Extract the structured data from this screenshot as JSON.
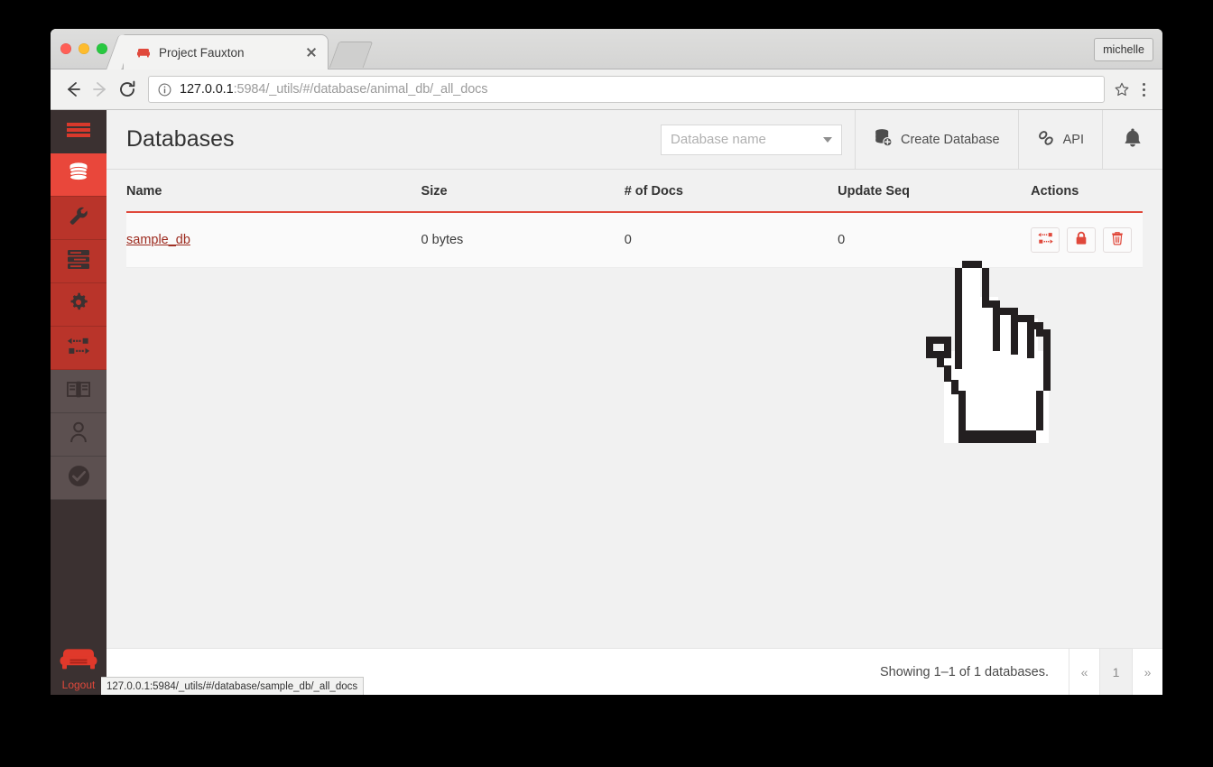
{
  "browser": {
    "tab": {
      "title": "Project Fauxton",
      "favicon_icon": "couch-favicon",
      "close_icon": "close-icon"
    },
    "new_tab_icon": "new-tab-icon",
    "profile_label": "michelle",
    "nav": {
      "back_icon": "back-arrow-icon",
      "forward_icon": "forward-arrow-icon",
      "reload_icon": "reload-icon"
    },
    "url": {
      "info_icon": "info-circle-icon",
      "host": "127.0.0.1",
      "path": ":5984/_utils/#/database/animal_db/_all_docs",
      "star_icon": "bookmark-star-icon",
      "menu_icon": "three-dot-menu-icon"
    },
    "status_link": "127.0.0.1:5984/_utils/#/database/sample_db/_all_docs"
  },
  "sidebar": {
    "items": [
      {
        "name": "menu-toggle",
        "icon": "hamburger-icon",
        "style": "burger"
      },
      {
        "name": "databases",
        "icon": "database-icon",
        "style": "red active"
      },
      {
        "name": "setup",
        "icon": "wrench-icon",
        "style": "red"
      },
      {
        "name": "active-tasks",
        "icon": "server-list-icon",
        "style": "red"
      },
      {
        "name": "configuration",
        "icon": "gear-icon",
        "style": "red"
      },
      {
        "name": "replication",
        "icon": "replicate-icon",
        "style": "red"
      },
      {
        "name": "documentation",
        "icon": "book-icon",
        "style": "gray"
      },
      {
        "name": "user-account",
        "icon": "user-icon",
        "style": "gray"
      },
      {
        "name": "verify",
        "icon": "check-circle-icon",
        "style": "gray"
      }
    ],
    "logo_icon": "couchdb-couch-logo",
    "logout_label": "Logout"
  },
  "header": {
    "title": "Databases",
    "search_placeholder": "Database name",
    "search_value": "",
    "search_caret_icon": "chevron-down-icon",
    "create_database_label": "Create Database",
    "create_database_icon": "database-plus-icon",
    "api_label": "API",
    "api_icon": "link-chain-icon",
    "notification_icon": "bell-icon"
  },
  "table": {
    "columns": [
      "Name",
      "Size",
      "# of Docs",
      "Update Seq",
      "Actions"
    ],
    "rows": [
      {
        "name": "sample_db",
        "size": "0 bytes",
        "docs": "0",
        "update_seq": "0",
        "actions": [
          {
            "name": "replicate-database-button",
            "icon": "replicate-icon"
          },
          {
            "name": "database-permissions-button",
            "icon": "lock-icon"
          },
          {
            "name": "delete-database-button",
            "icon": "trash-icon"
          }
        ]
      }
    ]
  },
  "footer": {
    "showing_text": "Showing 1–1 of 1 databases.",
    "prev_label": "«",
    "page_label": "1",
    "next_label": "»"
  },
  "colors": {
    "accent_red": "#e0493c",
    "sidebar_dark": "#3b3131",
    "sidebar_red": "#b9342a",
    "link_red": "#9c2a1e"
  }
}
